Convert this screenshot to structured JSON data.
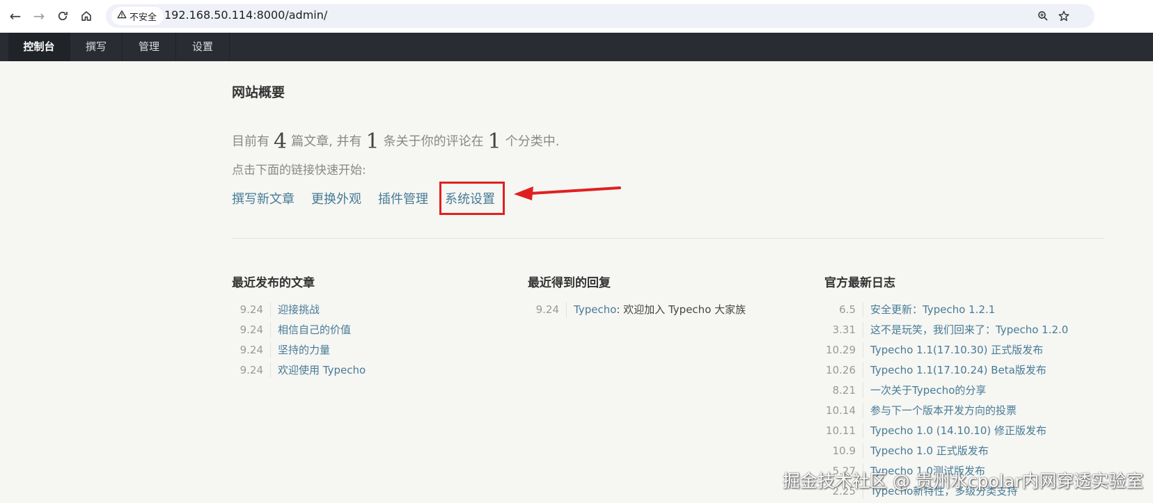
{
  "browser": {
    "security_label": "不安全",
    "url": "192.168.50.114:8000/admin/"
  },
  "admin_nav": {
    "items": [
      {
        "label": "控制台"
      },
      {
        "label": "撰写"
      },
      {
        "label": "管理"
      },
      {
        "label": "设置"
      }
    ]
  },
  "overview": {
    "title": "网站概要",
    "summary": {
      "prefix": "目前有",
      "posts": "4",
      "posts_suffix": "篇文章, 并有",
      "comments": "1",
      "comments_suffix": "条关于你的评论在",
      "categories": "1",
      "categories_suffix": "个分类中."
    },
    "quick_hint": "点击下面的链接快速开始:",
    "quick_links": [
      "撰写新文章",
      "更换外观",
      "插件管理",
      "系统设置"
    ]
  },
  "recent_posts": {
    "title": "最近发布的文章",
    "items": [
      {
        "date": "9.24",
        "title": "迎接挑战"
      },
      {
        "date": "9.24",
        "title": "相信自己的价值"
      },
      {
        "date": "9.24",
        "title": "坚持的力量"
      },
      {
        "date": "9.24",
        "title": "欢迎使用 Typecho"
      }
    ]
  },
  "recent_replies": {
    "title": "最近得到的回复",
    "items": [
      {
        "date": "9.24",
        "author": "Typecho",
        "text": ": 欢迎加入 Typecho 大家族"
      }
    ]
  },
  "official_log": {
    "title": "官方最新日志",
    "items": [
      {
        "date": "6.5",
        "title": "安全更新：Typecho 1.2.1"
      },
      {
        "date": "3.31",
        "title": "这不是玩笑，我们回来了：Typecho 1.2.0"
      },
      {
        "date": "10.29",
        "title": "Typecho 1.1(17.10.30) 正式版发布"
      },
      {
        "date": "10.26",
        "title": "Typecho 1.1(17.10.24) Beta版发布"
      },
      {
        "date": "8.21",
        "title": "一次关于Typecho的分享"
      },
      {
        "date": "10.14",
        "title": "参与下一个版本开发方向的投票"
      },
      {
        "date": "10.11",
        "title": "Typecho 1.0 (14.10.10) 修正版发布"
      },
      {
        "date": "10.9",
        "title": "Typecho 1.0 正式版发布"
      },
      {
        "date": "5.27",
        "title": "Typecho 1.0测试版发布"
      },
      {
        "date": "2.25",
        "title": "Typecho新特性，多级分类支持"
      }
    ]
  },
  "watermark": "掘金技术社区 @ 贵州水cpolar内网穿透实验室"
}
